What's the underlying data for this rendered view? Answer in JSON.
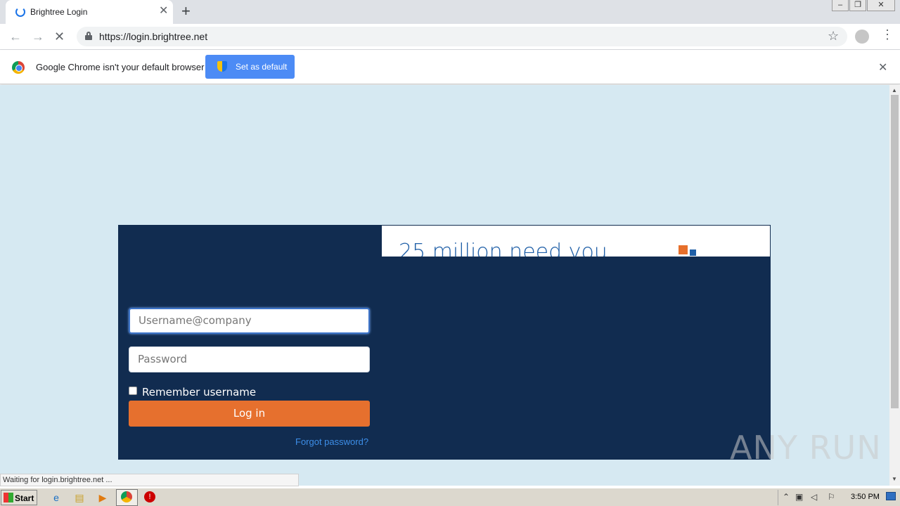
{
  "browser": {
    "tab_title": "Brightree Login",
    "url": "https://login.brightree.net",
    "infobar_text": "Google Chrome isn't your default browser",
    "set_default_label": "Set as default",
    "status_text": "Waiting for login.brightree.net ..."
  },
  "login": {
    "promo_title": "25 million need you",
    "username_placeholder": "Username@company",
    "password_placeholder": "Password",
    "remember_label": "Remember username",
    "login_button": "Log in",
    "forgot_link": "Forgot password?"
  },
  "watermark": "ANY RUN",
  "taskbar": {
    "start_label": "Start",
    "clock": "3:50 PM"
  },
  "colors": {
    "panel": "#112c50",
    "page_bg": "#d6e9f2",
    "login_button": "#e6702e",
    "link": "#3d8ee8"
  }
}
